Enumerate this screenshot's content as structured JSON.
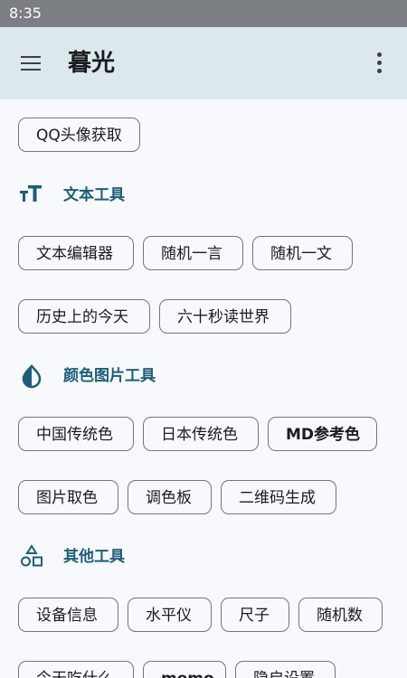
{
  "status_bar": {
    "time": "8:35"
  },
  "app_bar": {
    "title": "暮光"
  },
  "top_tools": [
    "QQ头像获取"
  ],
  "sections": [
    {
      "title": "文本工具",
      "icon": "text-format-icon",
      "rows": [
        [
          "文本编辑器",
          "随机一言",
          "随机一文"
        ],
        [
          "历史上的今天",
          "六十秒读世界"
        ]
      ]
    },
    {
      "title": "颜色图片工具",
      "icon": "water-drop-icon",
      "rows": [
        [
          "中国传统色",
          "日本传统色",
          "MD参考色"
        ],
        [
          "图片取色",
          "调色板",
          "二维码生成"
        ]
      ]
    },
    {
      "title": "其他工具",
      "icon": "shapes-icon",
      "rows": [
        [
          "设备信息",
          "水平仪",
          "尺子",
          "随机数"
        ],
        [
          "今天吃什么",
          "memo",
          "隐启设置"
        ]
      ]
    }
  ],
  "colors": {
    "status_bar": "#7b7f83",
    "app_bar": "#dde7ee",
    "background": "#f7f9fc",
    "accent": "#1c5e78",
    "chip_border": "#72777d"
  }
}
